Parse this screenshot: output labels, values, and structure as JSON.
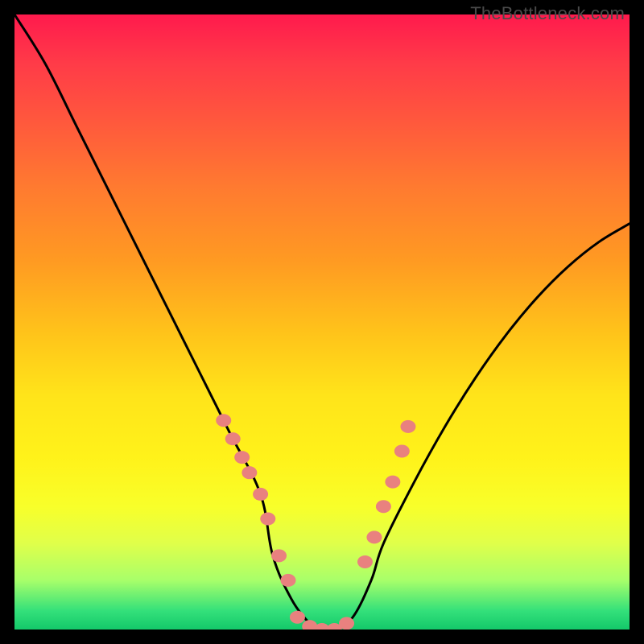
{
  "watermark": {
    "text": "TheBottleneck.com"
  },
  "chart_data": {
    "type": "line",
    "title": "",
    "xlabel": "",
    "ylabel": "",
    "xlim": [
      0,
      100
    ],
    "ylim": [
      0,
      100
    ],
    "grid": false,
    "series": [
      {
        "name": "bottleneck-curve",
        "color": "#000000",
        "x": [
          0,
          5,
          10,
          15,
          20,
          25,
          30,
          35,
          40,
          42,
          45,
          48,
          50,
          52,
          55,
          58,
          60,
          65,
          70,
          75,
          80,
          85,
          90,
          95,
          100
        ],
        "values": [
          100,
          92,
          82,
          72,
          62,
          52,
          42,
          32,
          22,
          12,
          5,
          1,
          0,
          0,
          2,
          8,
          14,
          24,
          33,
          41,
          48,
          54,
          59,
          63,
          66
        ]
      }
    ],
    "markers": [
      {
        "name": "left-band-markers",
        "color": "#e9817f",
        "x": [
          34,
          35.5,
          37,
          38.2,
          40,
          41.2,
          43,
          44.5
        ],
        "values": [
          34,
          31,
          28,
          25.5,
          22,
          18,
          12,
          8
        ]
      },
      {
        "name": "trough-markers",
        "color": "#e9817f",
        "x": [
          46,
          48,
          50,
          52,
          54
        ],
        "values": [
          2,
          0.5,
          0,
          0,
          1
        ]
      },
      {
        "name": "right-band-markers",
        "color": "#e9817f",
        "x": [
          57,
          58.5,
          60,
          61.5,
          63,
          64
        ],
        "values": [
          11,
          15,
          20,
          24,
          29,
          33
        ]
      }
    ],
    "background_gradient": {
      "type": "vertical",
      "stops": [
        {
          "pos": 0.0,
          "color": "#ff1a4d"
        },
        {
          "pos": 0.4,
          "color": "#ff9a22"
        },
        {
          "pos": 0.72,
          "color": "#fff21a"
        },
        {
          "pos": 0.97,
          "color": "#33e07a"
        },
        {
          "pos": 1.0,
          "color": "#14c96a"
        }
      ]
    }
  }
}
